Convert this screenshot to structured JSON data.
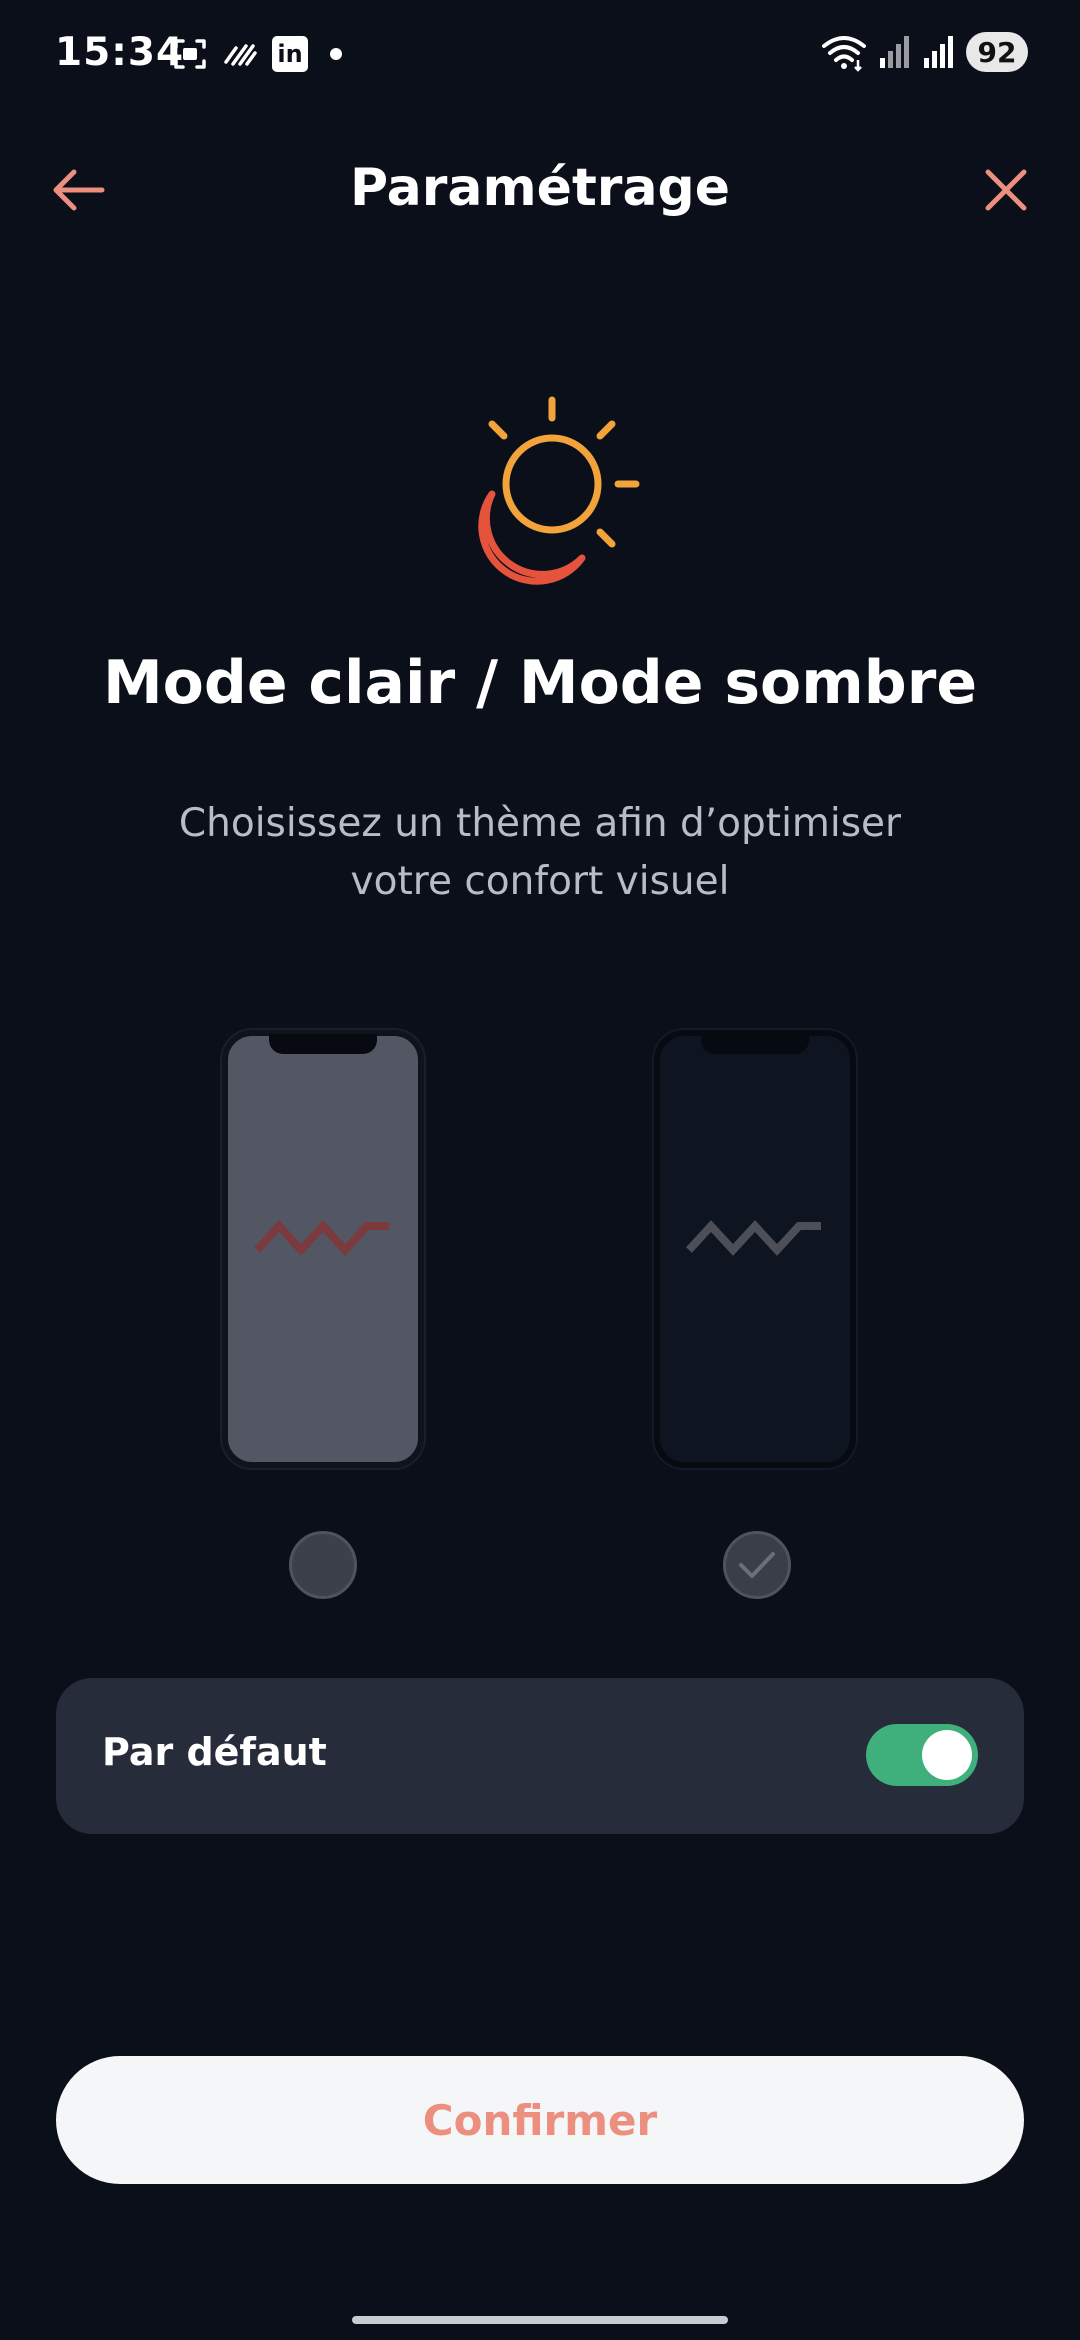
{
  "status_bar": {
    "time": "15:34",
    "battery": "92",
    "linkedin_letter": "in"
  },
  "header": {
    "title": "Paramétrage"
  },
  "hero": {
    "title": "Mode clair / Mode sombre",
    "subtitle_line1": "Choisissez un thème afin d’optimiser",
    "subtitle_line2": "votre confort visuel"
  },
  "themes": {
    "options": [
      {
        "name": "light",
        "selected": false
      },
      {
        "name": "dark",
        "selected": true
      }
    ]
  },
  "default_setting": {
    "label": "Par défaut",
    "enabled": true
  },
  "actions": {
    "confirm_label": "Confirmer"
  },
  "colors": {
    "background": "#0a0f1a",
    "accent": "#ec8f7f",
    "toggle_on": "#3fb07b",
    "card": "#272c3b",
    "sun": "#f2a43a",
    "moon": "#e5533d"
  }
}
